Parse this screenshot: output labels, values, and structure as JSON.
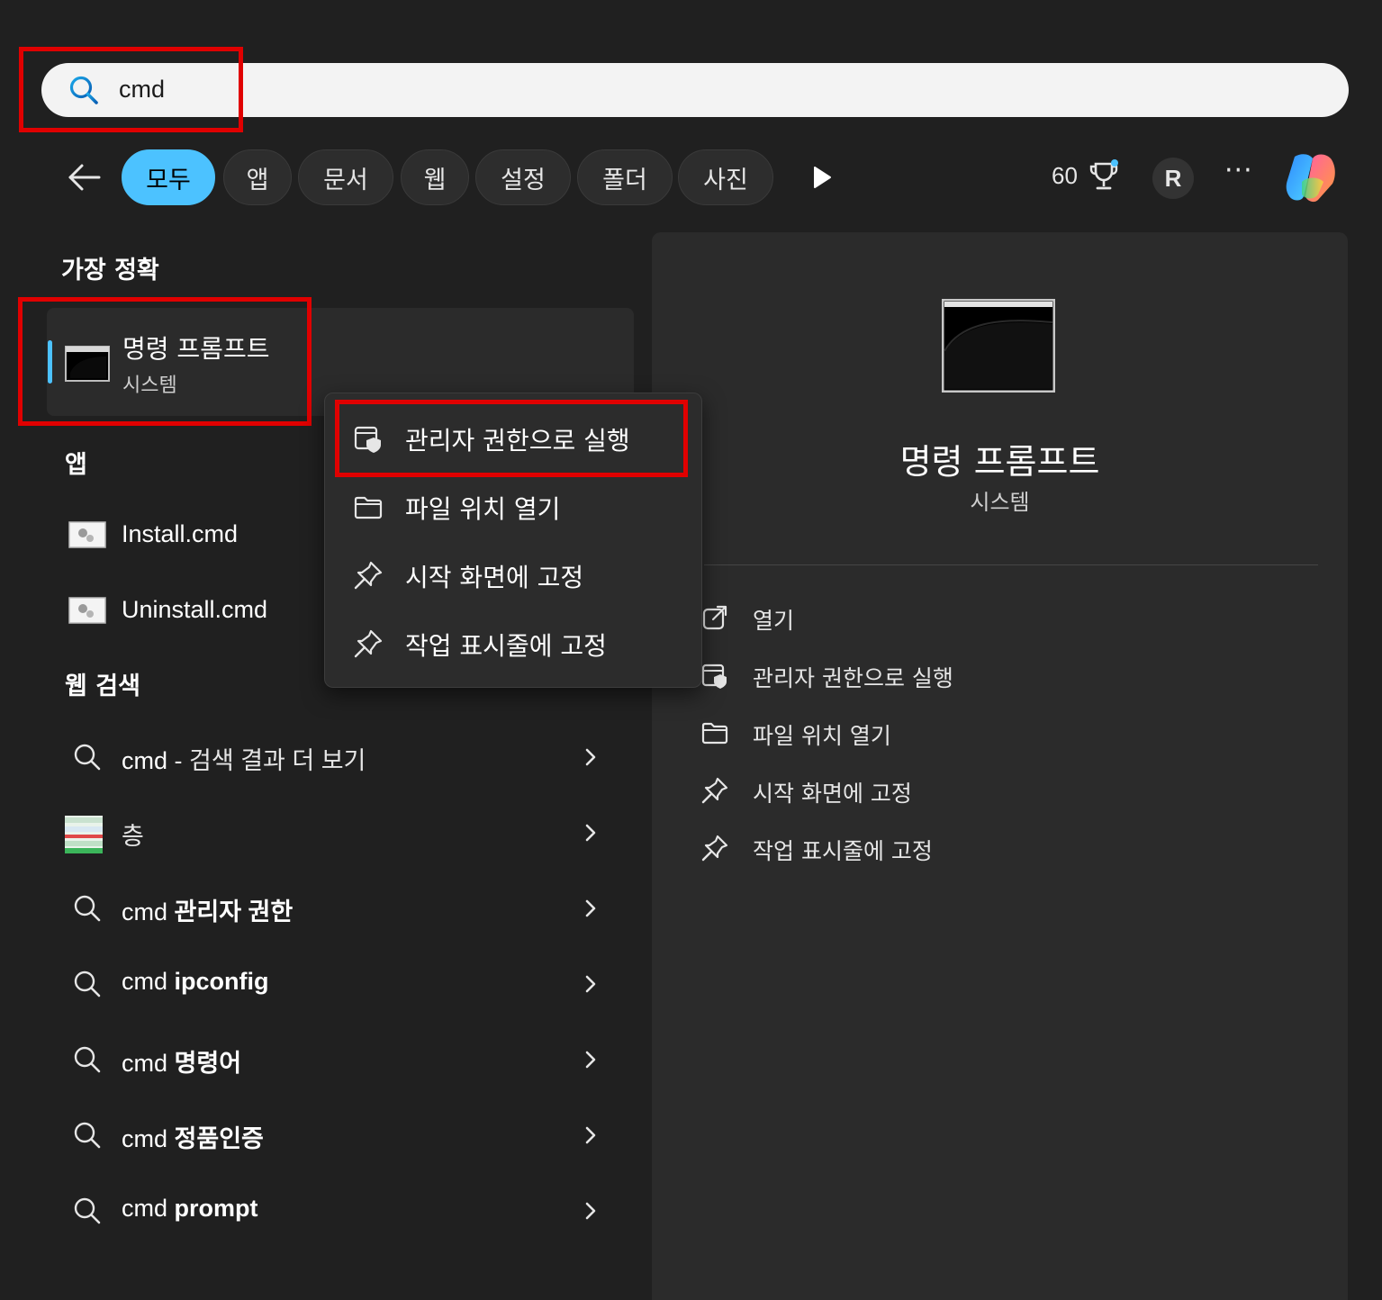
{
  "search": {
    "query": "cmd"
  },
  "filters": {
    "tabs": [
      {
        "label": "모두"
      },
      {
        "label": "앱"
      },
      {
        "label": "문서"
      },
      {
        "label": "웹"
      },
      {
        "label": "설정"
      },
      {
        "label": "폴더"
      },
      {
        "label": "사진"
      }
    ],
    "points": "60",
    "avatar_initial": "R",
    "more": "···"
  },
  "best_match": {
    "header": "가장 정확",
    "title": "명령 프롬프트",
    "subtitle": "시스템"
  },
  "apps": {
    "header": "앱",
    "items": [
      {
        "label": "Install.cmd"
      },
      {
        "label": "Uninstall.cmd"
      }
    ]
  },
  "web": {
    "header": "웹 검색",
    "items": [
      {
        "prefix": "cmd",
        "bold": "",
        "suffix": " - 검색 결과 더 보기",
        "icon": "search-icon"
      },
      {
        "prefix": "",
        "bold": "",
        "suffix": "층",
        "icon": "layer-thumbnail"
      },
      {
        "prefix": "cmd ",
        "bold": "관리자 권한",
        "suffix": "",
        "icon": "search-icon"
      },
      {
        "prefix": "cmd ",
        "bold": "ipconfig",
        "suffix": "",
        "icon": "search-icon"
      },
      {
        "prefix": "cmd ",
        "bold": "명령어",
        "suffix": "",
        "icon": "search-icon"
      },
      {
        "prefix": "cmd ",
        "bold": "정품인증",
        "suffix": "",
        "icon": "search-icon"
      },
      {
        "prefix": "cmd ",
        "bold": "prompt",
        "suffix": "",
        "icon": "search-icon"
      }
    ]
  },
  "context_menu": {
    "items": [
      {
        "label": "관리자 권한으로 실행",
        "icon": "shield-admin-icon"
      },
      {
        "label": "파일 위치 열기",
        "icon": "folder-icon"
      },
      {
        "label": "시작 화면에 고정",
        "icon": "pin-icon"
      },
      {
        "label": "작업 표시줄에 고정",
        "icon": "pin-icon"
      }
    ]
  },
  "preview": {
    "title": "명령 프롬프트",
    "subtitle": "시스템",
    "actions": [
      {
        "label": "열기",
        "icon": "open-external-icon"
      },
      {
        "label": "관리자 권한으로 실행",
        "icon": "shield-admin-icon"
      },
      {
        "label": "파일 위치 열기",
        "icon": "folder-icon"
      },
      {
        "label": "시작 화면에 고정",
        "icon": "pin-icon"
      },
      {
        "label": "작업 표시줄에 고정",
        "icon": "pin-icon"
      }
    ]
  },
  "colors": {
    "accent": "#4cc2ff",
    "highlight": "#e00000",
    "background": "#202020",
    "panel": "#2b2b2b"
  }
}
